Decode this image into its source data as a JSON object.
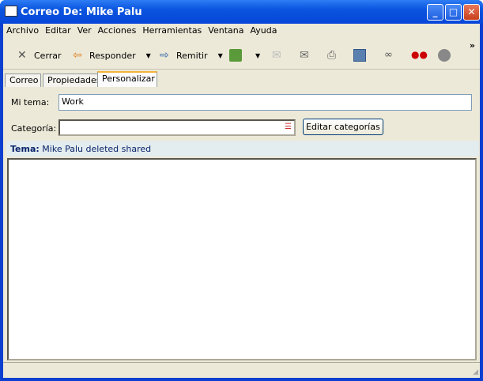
{
  "window": {
    "title": "Correo De:  Mike Palu"
  },
  "menu": [
    "Archivo",
    "Editar",
    "Ver",
    "Acciones",
    "Herramientas",
    "Ventana",
    "Ayuda"
  ],
  "toolbar": {
    "close": "Cerrar",
    "reply": "Responder",
    "forward": "Remitir",
    "more": "»"
  },
  "tabs": [
    "Correo",
    "Propiedades",
    "Personalizar"
  ],
  "form": {
    "my_subject_label": "Mi tema:",
    "my_subject_value": "Work",
    "category_label": "Categoría:",
    "category_value": "",
    "edit_categories": "Editar categorías"
  },
  "subject": {
    "label": "Tema:",
    "value": "Mike Palu deleted shared"
  }
}
